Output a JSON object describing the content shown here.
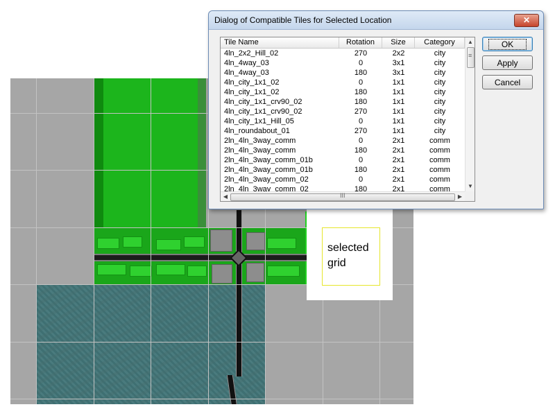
{
  "dialog": {
    "title": "Dialog of Compatible Tiles for Selected Location",
    "close_glyph": "✕",
    "columns": [
      "Tile Name",
      "Rotation",
      "Size",
      "Category"
    ],
    "rows": [
      [
        "4ln_2x2_Hill_02",
        "270",
        "2x2",
        "city"
      ],
      [
        "4ln_4way_03",
        "0",
        "3x1",
        "city"
      ],
      [
        "4ln_4way_03",
        "180",
        "3x1",
        "city"
      ],
      [
        "4ln_city_1x1_02",
        "0",
        "1x1",
        "city"
      ],
      [
        "4ln_city_1x1_02",
        "180",
        "1x1",
        "city"
      ],
      [
        "4ln_city_1x1_crv90_02",
        "180",
        "1x1",
        "city"
      ],
      [
        "4ln_city_1x1_crv90_02",
        "270",
        "1x1",
        "city"
      ],
      [
        "4ln_city_1x1_Hill_05",
        "0",
        "1x1",
        "city"
      ],
      [
        "4ln_roundabout_01",
        "270",
        "1x1",
        "city"
      ],
      [
        "2ln_4ln_3way_comm",
        "0",
        "2x1",
        "comm"
      ],
      [
        "2ln_4ln_3way_comm",
        "180",
        "2x1",
        "comm"
      ],
      [
        "2ln_4ln_3way_comm_01b",
        "0",
        "2x1",
        "comm"
      ],
      [
        "2ln_4ln_3way_comm_01b",
        "180",
        "2x1",
        "comm"
      ],
      [
        "2ln_4ln_3way_comm_02",
        "0",
        "2x1",
        "comm"
      ],
      [
        "2ln_4ln_3way_comm_02",
        "180",
        "2x1",
        "comm"
      ]
    ],
    "buttons": {
      "ok": "OK",
      "apply": "Apply",
      "cancel": "Cancel"
    },
    "scroll": {
      "up": "▲",
      "down": "▼",
      "left": "◀",
      "right": "▶",
      "grip": "III"
    }
  },
  "map": {
    "selected_label": "selected\ngrid",
    "colors": {
      "grass": "#1cb51c",
      "bright_grass": "#21d121",
      "water": "#3e6f72",
      "road": "#111111",
      "empty": "#a6a6a6",
      "selection": "#e6e62a"
    }
  }
}
